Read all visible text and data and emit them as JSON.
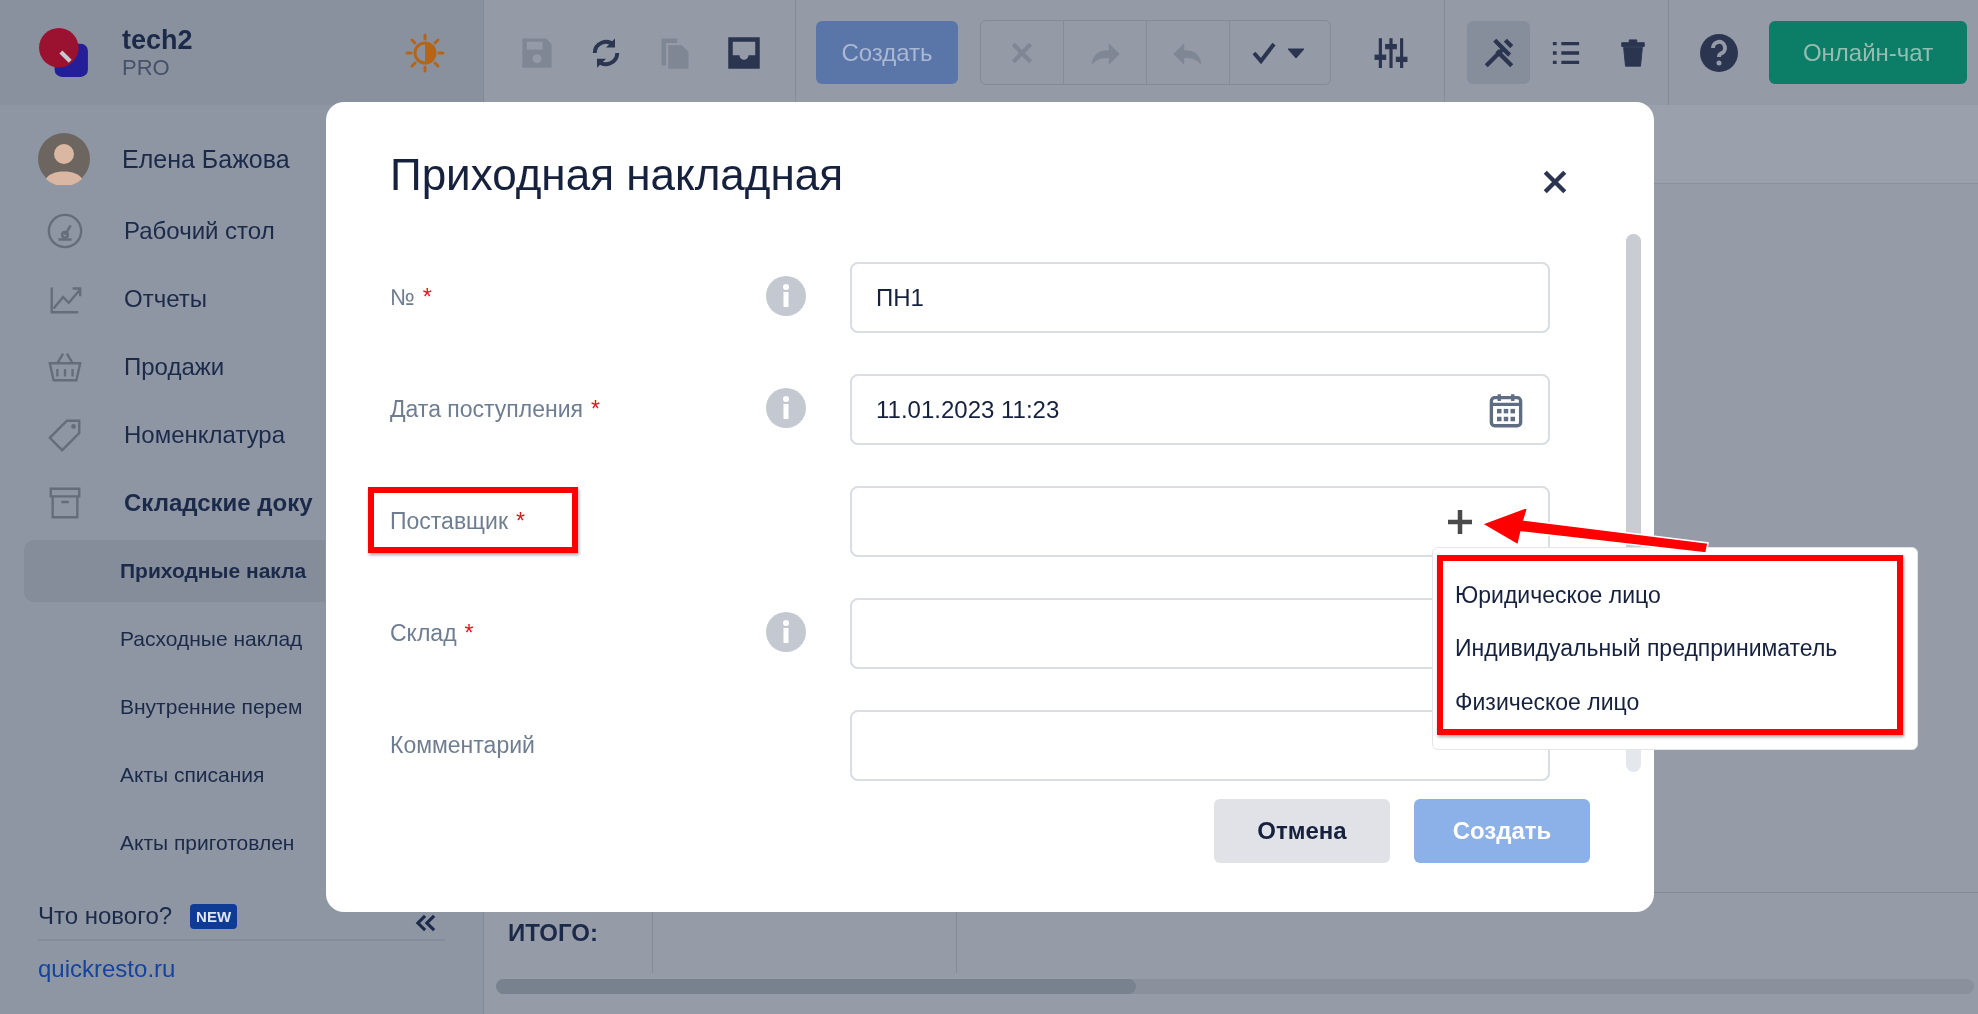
{
  "app": {
    "name": "tech2",
    "plan": "PRO"
  },
  "user": {
    "name": "Елена Бажова"
  },
  "sidebar": {
    "items": [
      {
        "label": "Рабочий стол",
        "expanded": false
      },
      {
        "label": "Отчеты",
        "expanded": false
      },
      {
        "label": "Продажи",
        "expanded": false
      },
      {
        "label": "Номенклатура",
        "expanded": false
      },
      {
        "label": "Складские доку",
        "expanded": true,
        "children": [
          {
            "label": "Приходные накла",
            "selected": true
          },
          {
            "label": "Расходные наклад",
            "selected": false
          },
          {
            "label": "Внутренние перем",
            "selected": false
          },
          {
            "label": "Акты списания",
            "selected": false
          },
          {
            "label": "Акты приготовлен",
            "selected": false
          }
        ]
      }
    ],
    "whats_new": {
      "label": "Что нового?",
      "badge": "NEW"
    },
    "link": "quickresto.ru"
  },
  "toolbar": {
    "icon_buttons": [
      {
        "disabled": true
      },
      {
        "disabled": false
      },
      {
        "disabled": true
      },
      {
        "disabled": false
      }
    ],
    "create_button": "Создать",
    "action_group": [
      {
        "disabled": true
      },
      {
        "disabled": true
      },
      {
        "disabled": true
      },
      {
        "disabled": false
      }
    ],
    "tool_buttons": [
      {
        "selected": false
      },
      {
        "selected": true
      },
      {
        "selected": false
      },
      {
        "selected": false
      }
    ],
    "chat_button": "Онлайн-чат"
  },
  "table": {
    "total_label": "ИТОГО:"
  },
  "dialog": {
    "title": "Приходная накладная",
    "fields": [
      {
        "label": "№",
        "required_mark": "*",
        "info": true,
        "kind": "text",
        "value": "ПН1"
      },
      {
        "label": "Дата поступления",
        "required_mark": "*",
        "info": true,
        "kind": "date",
        "value": "11.01.2023 11:23"
      },
      {
        "label": "Поставщик",
        "required_mark": "*",
        "info": false,
        "kind": "add"
      },
      {
        "label": "Склад",
        "required_mark": "*",
        "info": true,
        "kind": "text"
      },
      {
        "label": "Комментарий",
        "info": false,
        "kind": "text"
      }
    ],
    "menu": [
      "Юридическое лицо",
      "Индивидуальный предприниматель",
      "Физическое лицо"
    ],
    "cancel_button": "Отмена",
    "create_button": {
      "label": "Создать",
      "disabled": true
    }
  }
}
